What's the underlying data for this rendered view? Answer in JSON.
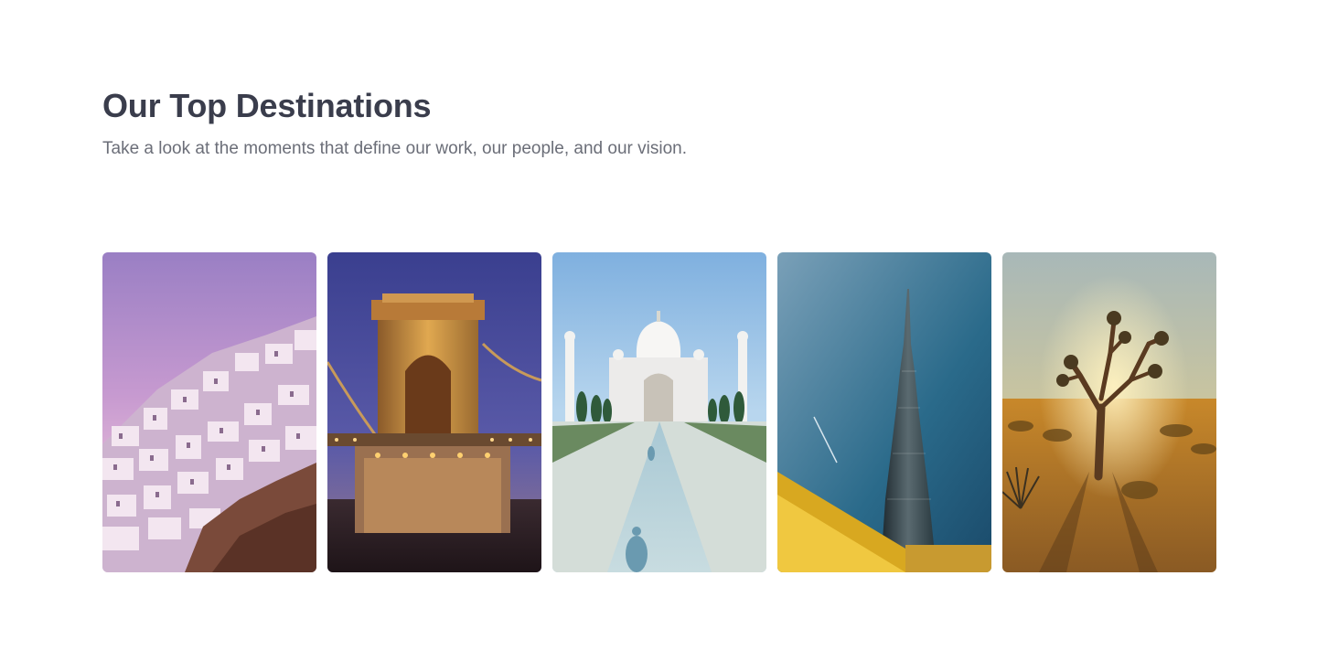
{
  "section": {
    "title": "Our Top Destinations",
    "subtitle": "Take a look at the moments that define our work, our people, and our vision."
  },
  "destinations": [
    {
      "icon": "santorini-photo"
    },
    {
      "icon": "chain-bridge-photo"
    },
    {
      "icon": "taj-mahal-photo"
    },
    {
      "icon": "burj-khalifa-photo"
    },
    {
      "icon": "joshua-tree-photo"
    }
  ],
  "colors": {
    "title": "#3a3d4c",
    "subtitle": "#6b6e78",
    "background": "#ffffff"
  }
}
